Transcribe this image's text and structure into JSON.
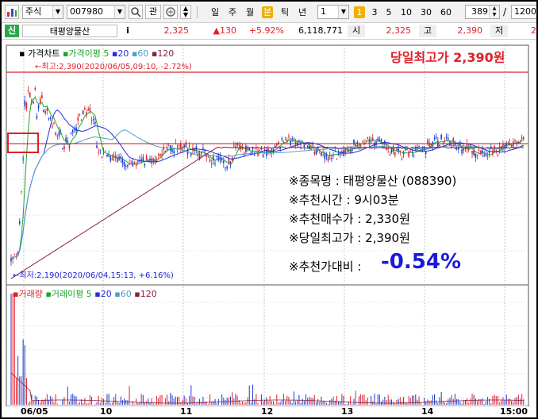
{
  "toolbar": {
    "market_select": "주식",
    "code_value": "007980",
    "search_icon": "magnifier-icon",
    "related_label": "관",
    "periods": [
      "일",
      "주",
      "월",
      "분",
      "틱",
      "년"
    ],
    "active_period": "분",
    "interval_value": "1",
    "interval_buttons": [
      "1",
      "3",
      "5",
      "10",
      "30",
      "60"
    ],
    "active_interval": "1",
    "count_value": "389",
    "slash": "/",
    "total_value": "1200"
  },
  "quote": {
    "badge": "신",
    "stock_name": "태평양물산",
    "info_btn": "i",
    "price": "2,325",
    "change": "▲130",
    "change_pct": "+5.92%",
    "volume": "6,118,771",
    "open_label": "시",
    "open_value": "2,325",
    "high_label": "고",
    "high_value": "2,390",
    "low_label": "저",
    "low_value": "2"
  },
  "legend": {
    "price_chart": "가격차트",
    "ma_label": "가격이평",
    "ma5": "5",
    "ma20": "20",
    "ma60": "60",
    "ma120": "120",
    "volume_label": "거래량",
    "vol_ma_label": "거래이평",
    "vma5": "5",
    "vma20": "20",
    "vma60": "60",
    "vma120": "120"
  },
  "annotations": {
    "high_marker": "←최고:2,390(2020/06/05,09:10, -2.72%)",
    "low_marker": "←최저:2,190(2020/06/04,15:13, +6.16%)",
    "headline": "당일최고가 2,390원",
    "info_lines": [
      "※종목명 : 태평양물산 (088390)",
      "※추천시간 : 9시03분",
      "※추천매수가 : 2,330원",
      "※당일최고가 : 2,390원"
    ],
    "compare_label": "※추천가대비 :",
    "compare_value": "-0.54%"
  },
  "x_axis": [
    "06/05",
    "10",
    "11",
    "12",
    "13",
    "14",
    "15:00"
  ],
  "colors": {
    "accent_red": "#e0202a",
    "compare_blue": "#1a1adc",
    "ma5": "#1fa52c",
    "ma20": "#2a2ae0",
    "ma60": "#4fa0c8",
    "ma120": "#8a2040",
    "hover_yellow": "#f0b000"
  }
}
